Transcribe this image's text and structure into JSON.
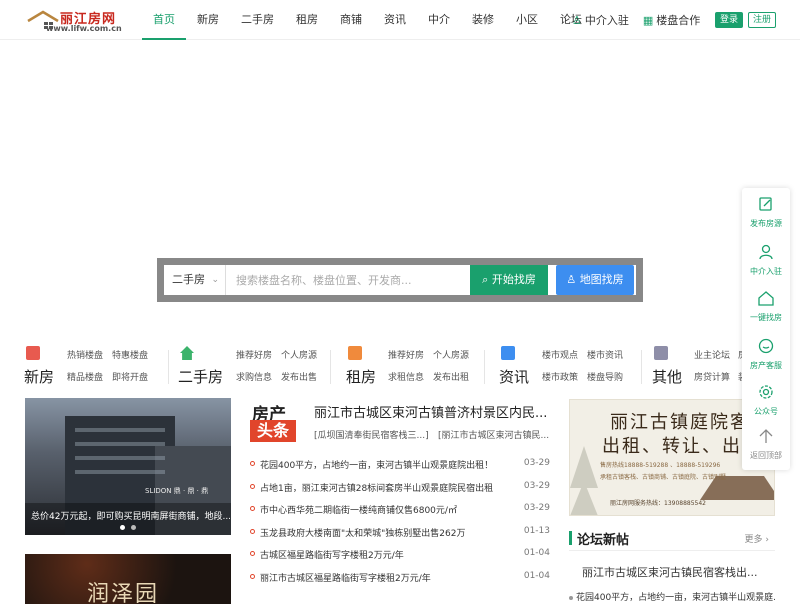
{
  "logo": {
    "brand": "丽江房网",
    "domain": "www.lifw.com.cn"
  },
  "nav": [
    "首页",
    "新房",
    "二手房",
    "租房",
    "商铺",
    "资讯",
    "中介",
    "装修",
    "小区",
    "论坛"
  ],
  "header_links": {
    "agent_join": "中介入驻",
    "cooperation": "楼盘合作",
    "login": "登录",
    "register": "注册"
  },
  "search": {
    "type_selected": "二手房",
    "placeholder": "搜索楼盘名称、楼盘位置、开发商...",
    "find_button": "开始找房",
    "map_button": "地图找房"
  },
  "categories": [
    {
      "name": "新房",
      "links": [
        "热销楼盘",
        "特惠楼盘",
        "精品楼盘",
        "即将开盘"
      ],
      "color": "#e85a4f"
    },
    {
      "name": "二手房",
      "links": [
        "推荐好房",
        "个人房源",
        "求购信息",
        "发布出售"
      ],
      "color": "#3bb36b"
    },
    {
      "name": "租房",
      "links": [
        "推荐好房",
        "个人房源",
        "求租信息",
        "发布出租"
      ],
      "color": "#f08a3c"
    },
    {
      "name": "资讯",
      "links": [
        "楼市观点",
        "楼市资讯",
        "楼市政策",
        "楼盘导购"
      ],
      "color": "#3d8ef0"
    },
    {
      "name": "其他",
      "links": [
        "业主论坛",
        "房",
        "房贷计算",
        "装"
      ],
      "color": "#8e8ea8"
    }
  ],
  "slider": {
    "sign": "SLIDON 鼎 · 鼎 · 鼎",
    "caption": "总价42万元起，即可购买昆明南屏街商铺，地段..."
  },
  "slider2": {
    "title": "润泽园"
  },
  "headline": {
    "badge_top": "房产",
    "badge_bottom": "头条",
    "title": "丽江市古城区束河古镇普济村景区内民...",
    "sub1": "[瓜坝国清奉街民宿客栈三...]",
    "sub2": "[丽江市古城区束河古镇民..."
  },
  "news": [
    {
      "text": "花园400平方，占地约一亩，束河古镇半山观景庭院出租！",
      "date": "03-29"
    },
    {
      "text": "占地1亩，丽江束河古镇28标间套房半山观景庭院民宿出租",
      "date": "03-29"
    },
    {
      "text": "市中心西华苑二期临街一楼纯商铺仅售6800元/㎡",
      "date": "03-29"
    },
    {
      "text": "玉龙县政府大楼南面\"太和荣城\"独栋别墅出售262万",
      "date": "01-13"
    },
    {
      "text": "古城区福星路临街写字楼租2万元/年",
      "date": "01-04"
    },
    {
      "text": "丽江市古城区福星路临街写字楼租2万元/年",
      "date": "01-04"
    }
  ],
  "banner": {
    "line1": "丽江古镇庭院客栈",
    "line2": "出租、转让、出售",
    "line3": "售房热线18888-519288 、18888-519296",
    "line4": "承租古镇客栈、古镇商铺、古镇庭院、古镇别墅",
    "line5": "丽江房网服务热线：13908885542"
  },
  "forum": {
    "title": "论坛新帖",
    "more": "更多 ›",
    "top_post": "丽江市古城区束河古镇民宿客栈出...",
    "post": "花园400平方，占地约一亩，束河古镇半山观景庭..."
  },
  "float_panel": [
    "发布房源",
    "中介入驻",
    "一键找房",
    "房产客服",
    "公众号",
    "返回顶部"
  ],
  "colors": {
    "accent": "#1aa06d",
    "map_button": "#3d8ef0",
    "headline_red": "#e1452b"
  }
}
